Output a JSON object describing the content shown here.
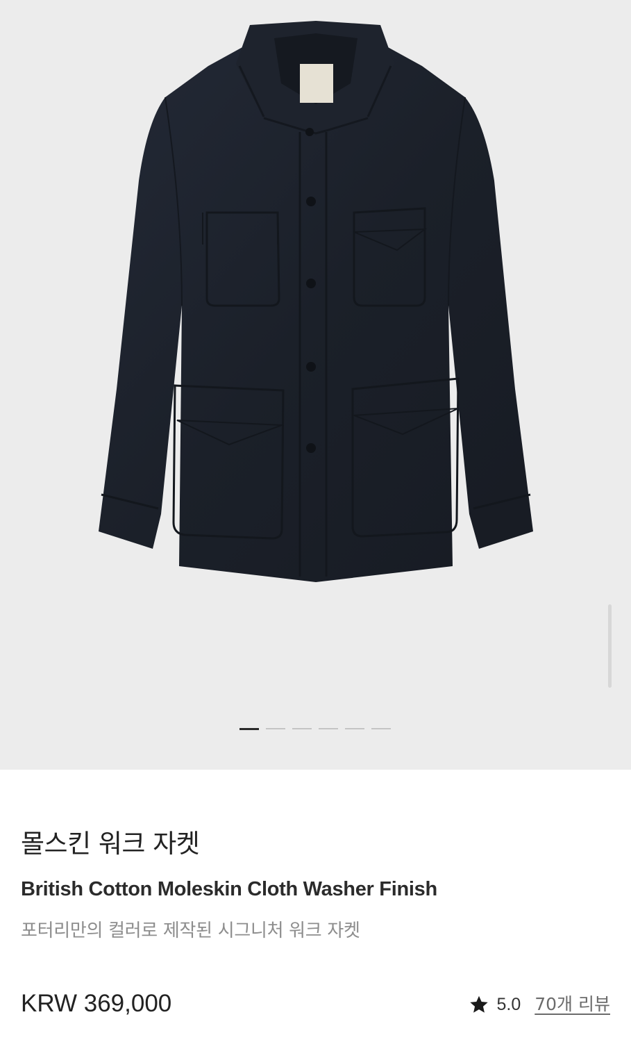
{
  "product": {
    "name_ko": "몰스킨 워크 자켓",
    "name_en": "British Cotton Moleskin Cloth Washer Finish",
    "subtitle": "포터리만의 컬러로 제작된 시그니처 워크 자켓",
    "price": "KRW 369,000",
    "rating": "5.0",
    "reviews_label": "70개 리뷰"
  },
  "gallery": {
    "image_icon": "jacket-photo",
    "slide_count": 6,
    "active_slide": 1
  },
  "icons": {
    "rating": "star-icon"
  },
  "colors": {
    "gallery_bg": "#ececec",
    "jacket": "#1c212b",
    "active_dot": "#2a2a2a"
  }
}
